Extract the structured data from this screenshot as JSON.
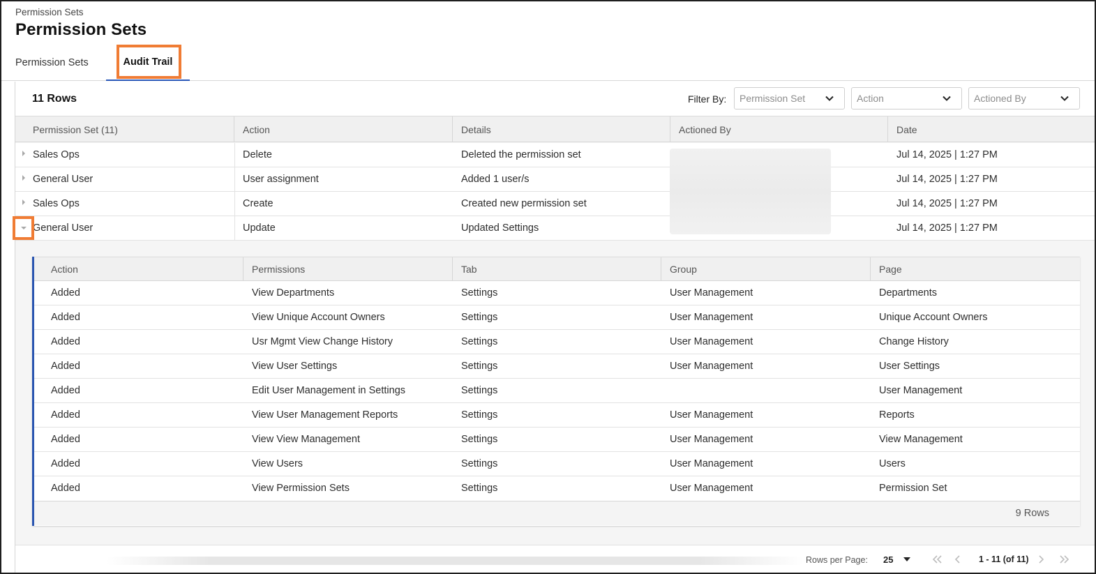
{
  "header": {
    "breadcrumb": "Permission Sets",
    "title": "Permission Sets"
  },
  "tabs": [
    {
      "label": "Permission Sets",
      "active": false
    },
    {
      "label": "Audit Trail",
      "active": true
    }
  ],
  "toolbar": {
    "row_count": "11 Rows",
    "filter_label": "Filter By:",
    "filters": [
      {
        "placeholder": "Permission Set"
      },
      {
        "placeholder": "Action"
      },
      {
        "placeholder": "Actioned By"
      }
    ]
  },
  "main_table": {
    "columns": [
      "Permission Set (11)",
      "Action",
      "Details",
      "Actioned By",
      "Date"
    ],
    "rows": [
      {
        "permission_set": "Sales Ops",
        "action": "Delete",
        "details": "Deleted the permission set",
        "actioned_by": "",
        "date": "Jul 14, 2025 | 1:27 PM",
        "expanded": false
      },
      {
        "permission_set": "General User",
        "action": "User assignment",
        "details": "Added 1 user/s",
        "actioned_by": "",
        "date": "Jul 14, 2025 | 1:27 PM",
        "expanded": false
      },
      {
        "permission_set": "Sales Ops",
        "action": "Create",
        "details": "Created new permission set",
        "actioned_by": "",
        "date": "Jul 14, 2025 | 1:27 PM",
        "expanded": false
      },
      {
        "permission_set": "General User",
        "action": "Update",
        "details": "Updated Settings",
        "actioned_by": "",
        "date": "Jul 14, 2025 | 1:27 PM",
        "expanded": true
      }
    ]
  },
  "detail_table": {
    "columns": [
      "Action",
      "Permissions",
      "Tab",
      "Group",
      "Page"
    ],
    "rows": [
      [
        "Added",
        "View Departments",
        "Settings",
        "User Management",
        "Departments"
      ],
      [
        "Added",
        "View Unique Account Owners",
        "Settings",
        "User Management",
        "Unique Account Owners"
      ],
      [
        "Added",
        "Usr Mgmt View Change History",
        "Settings",
        "User Management",
        "Change History"
      ],
      [
        "Added",
        "View User Settings",
        "Settings",
        "User Management",
        "User Settings"
      ],
      [
        "Added",
        "Edit User Management in Settings",
        "Settings",
        "",
        "User Management"
      ],
      [
        "Added",
        "View User Management Reports",
        "Settings",
        "User Management",
        "Reports"
      ],
      [
        "Added",
        "View View Management",
        "Settings",
        "User Management",
        "View Management"
      ],
      [
        "Added",
        "View Users",
        "Settings",
        "User Management",
        "Users"
      ],
      [
        "Added",
        "View Permission Sets",
        "Settings",
        "User Management",
        "Permission Set"
      ]
    ],
    "footer_count": "9 Rows"
  },
  "pagination": {
    "rows_per_page_label": "Rows per Page:",
    "rows_per_page": "25",
    "range": "1 - 11 (of 11)"
  },
  "colors": {
    "highlight": "#f07c34",
    "active_tab_underline": "#2856b8",
    "detail_accent": "#2a55b0"
  },
  "icons": [
    "chevron-down-icon",
    "caret-right-icon",
    "caret-down-icon",
    "first-page-icon",
    "prev-page-icon",
    "next-page-icon",
    "last-page-icon"
  ]
}
